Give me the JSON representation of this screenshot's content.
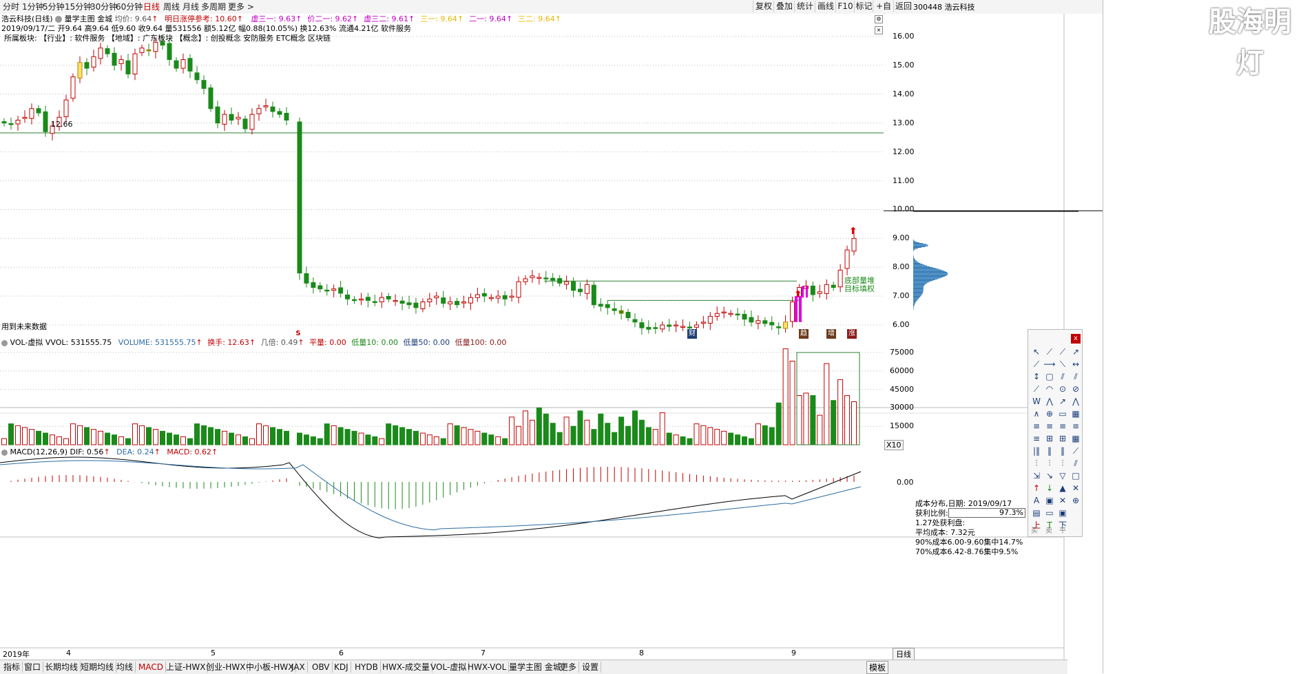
{
  "top_bar": {
    "periods": [
      "分时",
      "1分钟",
      "5分钟",
      "15分钟",
      "30分钟",
      "60分钟",
      "日线",
      "周线",
      "月线",
      "多周期",
      "更多 >"
    ],
    "active_period": "日线",
    "right_buttons": [
      "复权",
      "叠加",
      "统计",
      "画线",
      "F10",
      "标记",
      "+自选",
      "返回"
    ],
    "stock_header": "300448 浩云科技"
  },
  "logo": "股海明灯",
  "price_panel": {
    "title": "浩云科技(日线)",
    "indicator_name": "量学主图 金城",
    "avg_label": "均价: 9.64",
    "limit_label": "明日涨停参考: 10.60",
    "items": [
      {
        "label": "虚三一: 9.63",
        "color": "#c000c0"
      },
      {
        "label": "价二一: 9.62",
        "color": "#c000c0"
      },
      {
        "label": "虚三二: 9.61",
        "color": "#c000c0"
      },
      {
        "label": "三一: 9.64",
        "color": "#e6b800"
      },
      {
        "label": "二一: 9.64",
        "color": "#c000c0"
      },
      {
        "label": "三二: 9.64",
        "color": "#e6b800"
      }
    ],
    "ohlc_line": "2019/09/17/二  开9.64 高9.64 低9.60 收9.64 量531556 额5.12亿 幅0.88(10.05%) 换12.63% 流通4.21亿 软件服务",
    "sector_line": "所属板块:   【行业】: 软件服务      【地域】: 广东板块      【概念】: 创投概念 安防服务 ETC概念 区块链",
    "low_label": "12.66",
    "future_label": "用到未来数据",
    "annotation_1": "底部量堆",
    "annotation_2": "目标填权",
    "y_ticks": [
      "16.00",
      "15.00",
      "14.00",
      "13.00",
      "12.00",
      "11.00",
      "10.00",
      "9.00",
      "8.00",
      "7.00",
      "6.00"
    ],
    "markers": [
      "S",
      "财",
      "趋",
      "增",
      "涨"
    ]
  },
  "volume_panel": {
    "title": "VOL-虚拟",
    "vvol": "VVOL: 531555.75",
    "volume": "VOLUME: 531555.75",
    "turnover": "换手: 12.63",
    "jibei": "几倍: 0.49",
    "pingliang": "平量: 0.00",
    "dl10": "低量10: 0.00",
    "dl50": "低量50: 0.00",
    "dl100": "低量100: 0.00",
    "y_ticks": [
      "75000",
      "60000",
      "45000",
      "30000",
      "15000"
    ],
    "scale": "X10"
  },
  "macd_panel": {
    "title": "MACD(12,26,9)",
    "dif": "DIF: 0.56",
    "dea": "DEA: 0.24",
    "macd": "MACD: 0.62",
    "zero_tick": "0.00"
  },
  "date_axis": [
    "2019年",
    "4",
    "5",
    "6",
    "7",
    "8",
    "9"
  ],
  "bottom_tabs": [
    "指标",
    "窗口",
    "长期均线",
    "短期均线",
    "均线",
    "MACD",
    "上证-HWX",
    "创业-HWX",
    "中小板-HWX",
    "JAX",
    "OBV",
    "KDJ",
    "HYDB",
    "HWX-成交量",
    "VOL-虚拟",
    "HWX-VOL",
    "量学主图 金城",
    "更多",
    "设置"
  ],
  "active_bottom_tab": "MACD",
  "bottom_right_tab": "模板",
  "day_tab": "日线",
  "cost_panel": {
    "date_line": "成本分布,日期: 2019/09/17",
    "profit_label": "获利比例:",
    "profit_value": "97.3%",
    "profit_fraction": 0.973,
    "profit_line": "1.27处获利盘:",
    "avg_cost": "平均成本: 7.32元",
    "c90": "90%成本6.00-9.60集中14.7%",
    "c70": "70%成本6.42-8.76集中9.5%"
  },
  "tools": {
    "close": "x",
    "bottom_labels": [
      "买",
      "卖",
      "平"
    ]
  },
  "chart_data": {
    "type": "candlestick",
    "title": "",
    "x_labels": [
      "2019年",
      "4",
      "5",
      "6",
      "7",
      "8",
      "9"
    ],
    "ylim": [
      5.5,
      16.5
    ],
    "horizontal_lines": [
      12.66,
      7.52,
      6.85
    ],
    "cost_distribution_peak": 7.35,
    "last_close": 9.64,
    "volume_ylim": [
      0,
      80000
    ],
    "macd_last": {
      "dif": 0.56,
      "dea": 0.24,
      "macd": 0.62
    }
  },
  "colors": {
    "up": "#c00000",
    "down": "#1a8a1a",
    "line": "#2e7d32",
    "dif": "#000000",
    "dea": "#2b6ca3",
    "cost": "#1f6fb0"
  }
}
